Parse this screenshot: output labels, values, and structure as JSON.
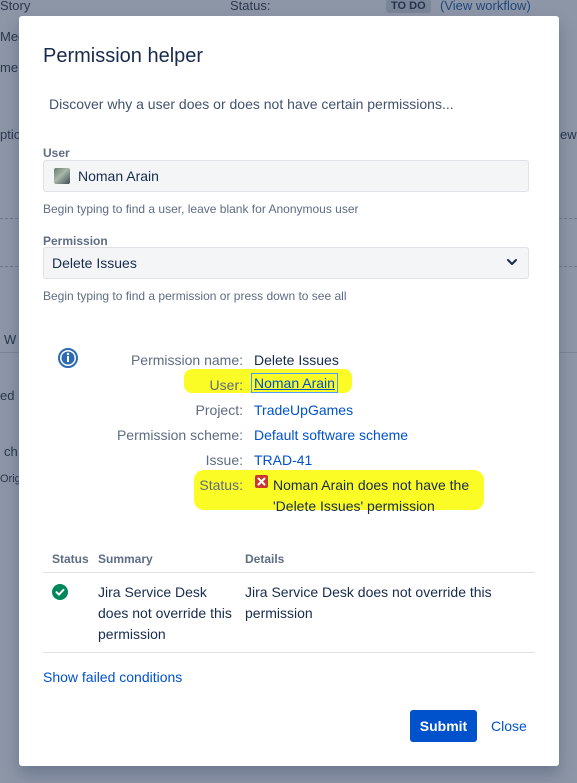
{
  "background": {
    "fragments": [
      {
        "text": "Story",
        "style": ""
      },
      {
        "text": "Status:",
        "style": ""
      },
      {
        "text": "TO DO",
        "style": "badge"
      },
      {
        "text": "(View workflow)",
        "style": "link"
      },
      {
        "text": "Med",
        "style": ""
      },
      {
        "text": "me",
        "style": ""
      },
      {
        "text": "ptio",
        "style": ""
      },
      {
        "text": "ew",
        "style": ""
      },
      {
        "text": "W",
        "style": ""
      },
      {
        "text": "ed i",
        "style": ""
      },
      {
        "text": "ch",
        "style": ""
      },
      {
        "text": "Origi",
        "style": ""
      }
    ]
  },
  "dialog": {
    "title": "Permission helper",
    "description": "Discover why a user does or does not have certain permissions...",
    "user_field": {
      "label": "User",
      "value": "Noman Arain",
      "hint": "Begin typing to find a user, leave blank for Anonymous user"
    },
    "permission_field": {
      "label": "Permission",
      "value": "Delete Issues",
      "hint": "Begin typing to find a permission or press down to see all"
    },
    "result": {
      "rows": [
        {
          "label": "Permission name:",
          "value": "Delete Issues"
        },
        {
          "label": "User:",
          "value": "Noman Arain"
        },
        {
          "label": "Project:",
          "value": "TradeUpGames"
        },
        {
          "label": "Permission scheme:",
          "value": "Default software scheme"
        },
        {
          "label": "Issue:",
          "value": "TRAD-41"
        },
        {
          "label": "Status:",
          "value": "Noman Arain does not have the 'Delete Issues' permission"
        }
      ],
      "highlight_color": "#fbfb26"
    },
    "table": {
      "headers": [
        "Status",
        "Summary",
        "Details"
      ],
      "rows": [
        {
          "status": "check-circle-icon",
          "summary": "Jira Service Desk does not override this permission",
          "details": "Jira Service Desk does not override this permission"
        }
      ]
    },
    "show_failed": "Show failed conditions",
    "submit_label": "Submit",
    "close_label": "Close",
    "colors": {
      "primary": "#0052cc",
      "success": "#00875a",
      "error": "#c9372c",
      "info": "#2c6bb1"
    }
  }
}
